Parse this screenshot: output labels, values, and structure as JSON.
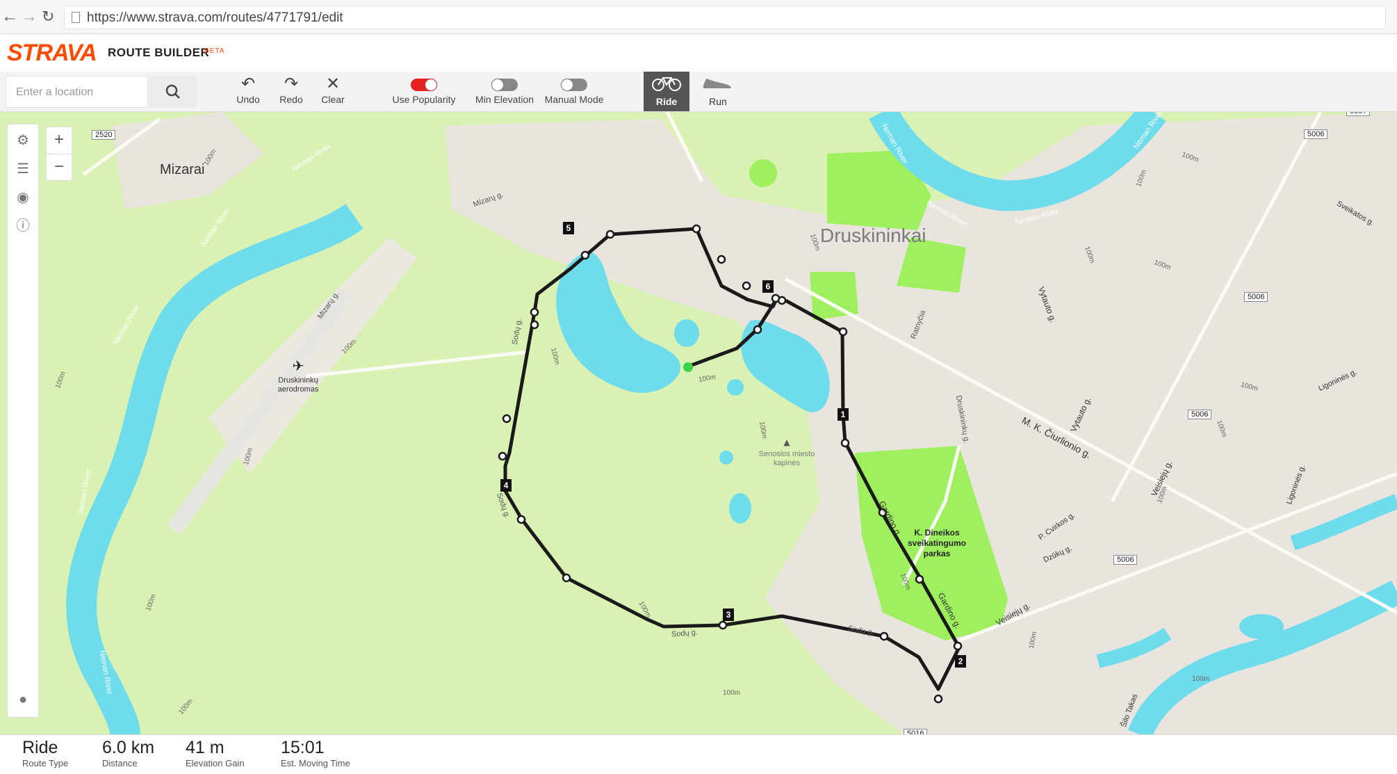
{
  "browser": {
    "back_icon": "arrow-left-icon",
    "forward_icon": "arrow-right-icon",
    "reload_icon": "reload-icon",
    "url": "https://www.strava.com/routes/4771791/edit"
  },
  "header": {
    "logo": "STRAVA",
    "title": "ROUTE BUILDER",
    "badge": "BETA",
    "brand_color": "#fc4c02"
  },
  "toolbar": {
    "search_placeholder": "Enter a location",
    "undo": "Undo",
    "redo": "Redo",
    "clear": "Clear",
    "use_popularity": "Use Popularity",
    "use_popularity_on": true,
    "min_elevation": "Min Elevation",
    "min_elevation_on": false,
    "manual_mode": "Manual Mode",
    "manual_mode_on": false,
    "ride": "Ride",
    "run": "Run",
    "active_sport": "Ride"
  },
  "map": {
    "colors": {
      "land": "#d9f2b4",
      "water": "#6fdcec",
      "park": "#9ef05e",
      "urban": "#e9e4de",
      "route": "#1a1a1a"
    },
    "labels": {
      "mizarai": "Mizarai",
      "druskininkai": "Druskininkai",
      "airport": "Druskininkų aerodromas",
      "cemetery": "Senosios miesto kapinės",
      "park": "K. Dineikos sveikatingumo parkas",
      "neman": "Neman River",
      "ciurlionio": "M. K. Čiurlionio g.",
      "gardino": "Gardino g.",
      "veisieju": "Veisiejų g.",
      "vytauto": "Vytauto g.",
      "sodu": "Sodų g.",
      "mizaru": "Mizarų g.",
      "druskininku": "Druskininkų g.",
      "cvirkos": "P. Cvirkos g.",
      "dzuku": "Dzūkų g.",
      "ligonines": "Ligoninės g.",
      "sveikatos": "Sveikatos g.",
      "takas": "Šilo Takas",
      "ratnycia": "Ratnyčia",
      "m100": "100m",
      "r2520": "2520",
      "r5006": "5006",
      "r5007": "5007",
      "r5016": "5016"
    },
    "markers": [
      "1",
      "2",
      "3",
      "4",
      "5",
      "6"
    ]
  },
  "stats": {
    "route_type": {
      "value": "Ride",
      "label": "Route Type"
    },
    "distance": {
      "value": "6.0 km",
      "label": "Distance"
    },
    "elevation_gain": {
      "value": "41 m",
      "label": "Elevation Gain"
    },
    "moving_time": {
      "value": "15:01",
      "label": "Est. Moving Time"
    }
  }
}
